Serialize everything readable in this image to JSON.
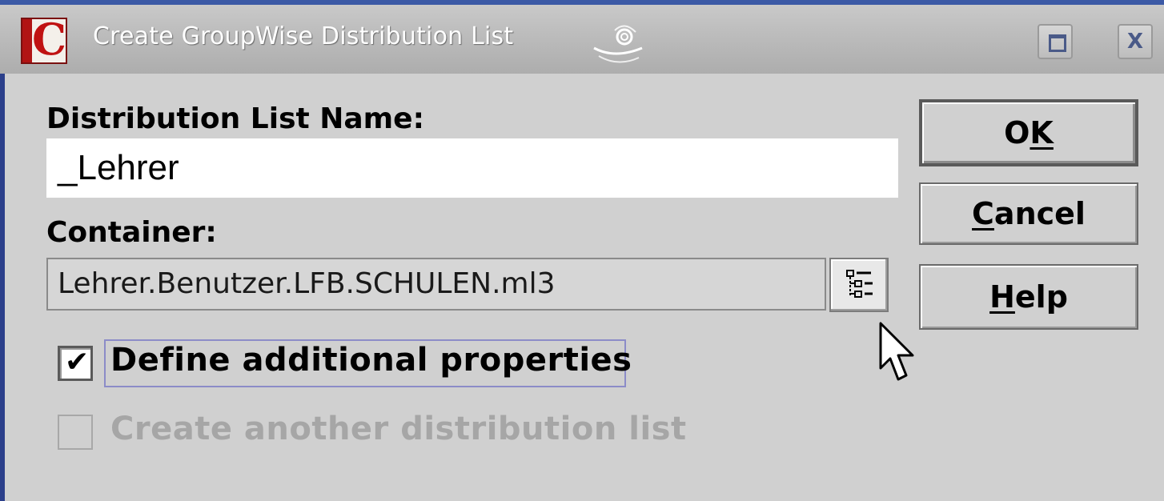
{
  "window": {
    "title": "Create GroupWise Distribution List",
    "app_icon_letter": "C",
    "close_glyph": "X"
  },
  "form": {
    "name_label": "Distribution List Name:",
    "name_value": "_Lehrer",
    "container_label": "Container:",
    "container_value": "Lehrer.Benutzer.LFB.SCHULEN.ml3"
  },
  "buttons": {
    "ok": {
      "pre": "O",
      "mnemonic": "K",
      "post": ""
    },
    "cancel": {
      "pre": "",
      "mnemonic": "C",
      "post": "ancel"
    },
    "help": {
      "pre": "",
      "mnemonic": "H",
      "post": "elp"
    }
  },
  "options": {
    "define_additional": {
      "label": "Define additional properties",
      "checked": true,
      "enabled": true
    },
    "create_another": {
      "label": "Create another distribution list",
      "checked": false,
      "enabled": false
    }
  },
  "icons": {
    "app": "groupwise-app-icon",
    "swirl": "swirl-decoration-icon",
    "maximize": "maximize-icon",
    "close": "close-icon",
    "browse": "tree-browse-icon",
    "cursor": "mouse-pointer-icon"
  },
  "colors": {
    "title_bar_accent": "#3c5aa6",
    "dialog_background": "#d0d0d0",
    "disabled_text": "#a6a6a6",
    "focus_border": "#8c8cc8"
  }
}
